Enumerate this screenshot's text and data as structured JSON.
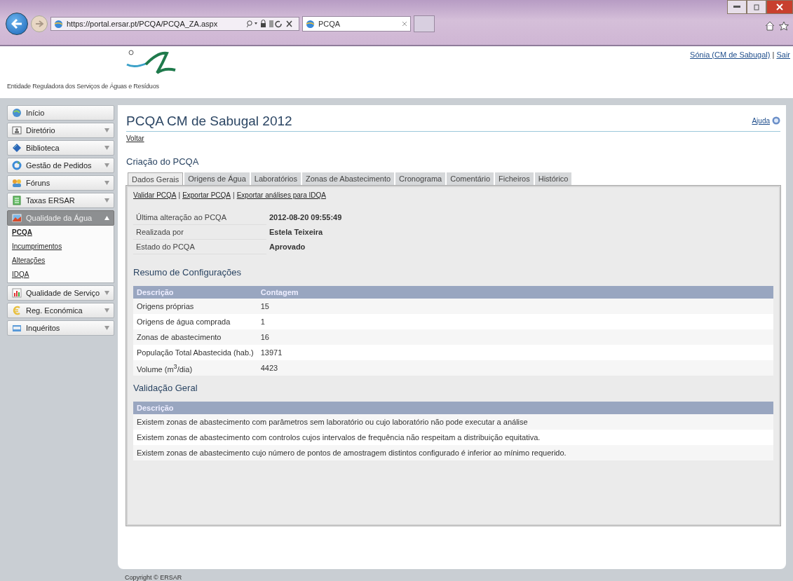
{
  "browser": {
    "address": "https://portal.ersar.pt/PCQA/PCQA_ZA.aspx",
    "tab_title": "PCQA"
  },
  "header": {
    "organization": "Entidade Reguladora dos Serviços de Águas e Resíduos",
    "user_link": "Sónia (CM de Sabugal)",
    "separator": "|",
    "logout_link": "Sair"
  },
  "sidebar": {
    "items": [
      {
        "label": "Início",
        "kind": "link",
        "selected": false
      },
      {
        "label": "Diretório",
        "kind": "menu",
        "selected": false,
        "expanded": false
      },
      {
        "label": "Biblioteca",
        "kind": "menu",
        "selected": false,
        "expanded": false
      },
      {
        "label": "Gestão de Pedidos",
        "kind": "menu",
        "selected": false,
        "expanded": false
      },
      {
        "label": "Fóruns",
        "kind": "menu",
        "selected": false,
        "expanded": false
      },
      {
        "label": "Taxas ERSAR",
        "kind": "menu",
        "selected": false,
        "expanded": false
      },
      {
        "label": "Qualidade da Água",
        "kind": "menu",
        "selected": true,
        "expanded": true,
        "children": [
          {
            "label": "PCQA",
            "selected": true
          },
          {
            "label": "Incumprimentos",
            "selected": false
          },
          {
            "label": "Alterações",
            "selected": false
          },
          {
            "label": "IDQA",
            "selected": false
          }
        ]
      },
      {
        "label": "Qualidade de Serviço",
        "kind": "menu",
        "selected": false,
        "expanded": false
      },
      {
        "label": "Reg. Económica",
        "kind": "menu",
        "selected": false,
        "expanded": false
      },
      {
        "label": "Inquéritos",
        "kind": "menu",
        "selected": false,
        "expanded": false
      }
    ]
  },
  "page": {
    "title": "PCQA CM de Sabugal 2012",
    "help_link": "Ajuda",
    "back_link": "Voltar",
    "section_title": "Criação do PCQA",
    "tabs": [
      {
        "label": "Dados Gerais",
        "selected": true
      },
      {
        "label": "Origens de Água",
        "selected": false
      },
      {
        "label": "Laboratórios",
        "selected": false
      },
      {
        "label": "Zonas de Abastecimento",
        "selected": false
      },
      {
        "label": "Cronograma",
        "selected": false
      },
      {
        "label": "Comentário",
        "selected": false
      },
      {
        "label": "Ficheiros",
        "selected": false
      },
      {
        "label": "Histórico",
        "selected": false
      }
    ],
    "actions": [
      {
        "label": "Validar PCQA"
      },
      {
        "label": "Exportar PCQA"
      },
      {
        "label": "Exportar análises para IDQA"
      }
    ],
    "action_separator": "|",
    "info": [
      {
        "label": "Última alteração ao PCQA",
        "value": "2012-08-20 09:55:49"
      },
      {
        "label": "Realizada por",
        "value": "Estela Teixeira"
      },
      {
        "label": "Estado do PCQA",
        "value": "Aprovado"
      }
    ],
    "summary": {
      "title": "Resumo de Configurações",
      "columns": [
        "Descrição",
        "Contagem"
      ],
      "rows": [
        [
          "Origens próprias",
          "15"
        ],
        [
          "Origens de água comprada",
          "1"
        ],
        [
          "Zonas de abastecimento",
          "16"
        ],
        [
          "População Total Abastecida (hab.)",
          "13971"
        ],
        [
          "Volume (m$^{3}$/dia)",
          "4423"
        ]
      ]
    },
    "validation": {
      "title": "Validação Geral",
      "columns": [
        "Descrição"
      ],
      "rows": [
        "Existem zonas de abastecimento com parâmetros sem laboratório ou cujo laboratório não pode executar a análise",
        "Existem zonas de abastecimento com controlos cujos intervalos de frequência não respeitam a distribuição equitativa.",
        "Existem zonas de abastecimento cujo número de pontos de amostragem distintos configurado é inferior ao mínimo requerido."
      ]
    }
  },
  "footer": {
    "copyright": "Copyright © ERSAR"
  }
}
